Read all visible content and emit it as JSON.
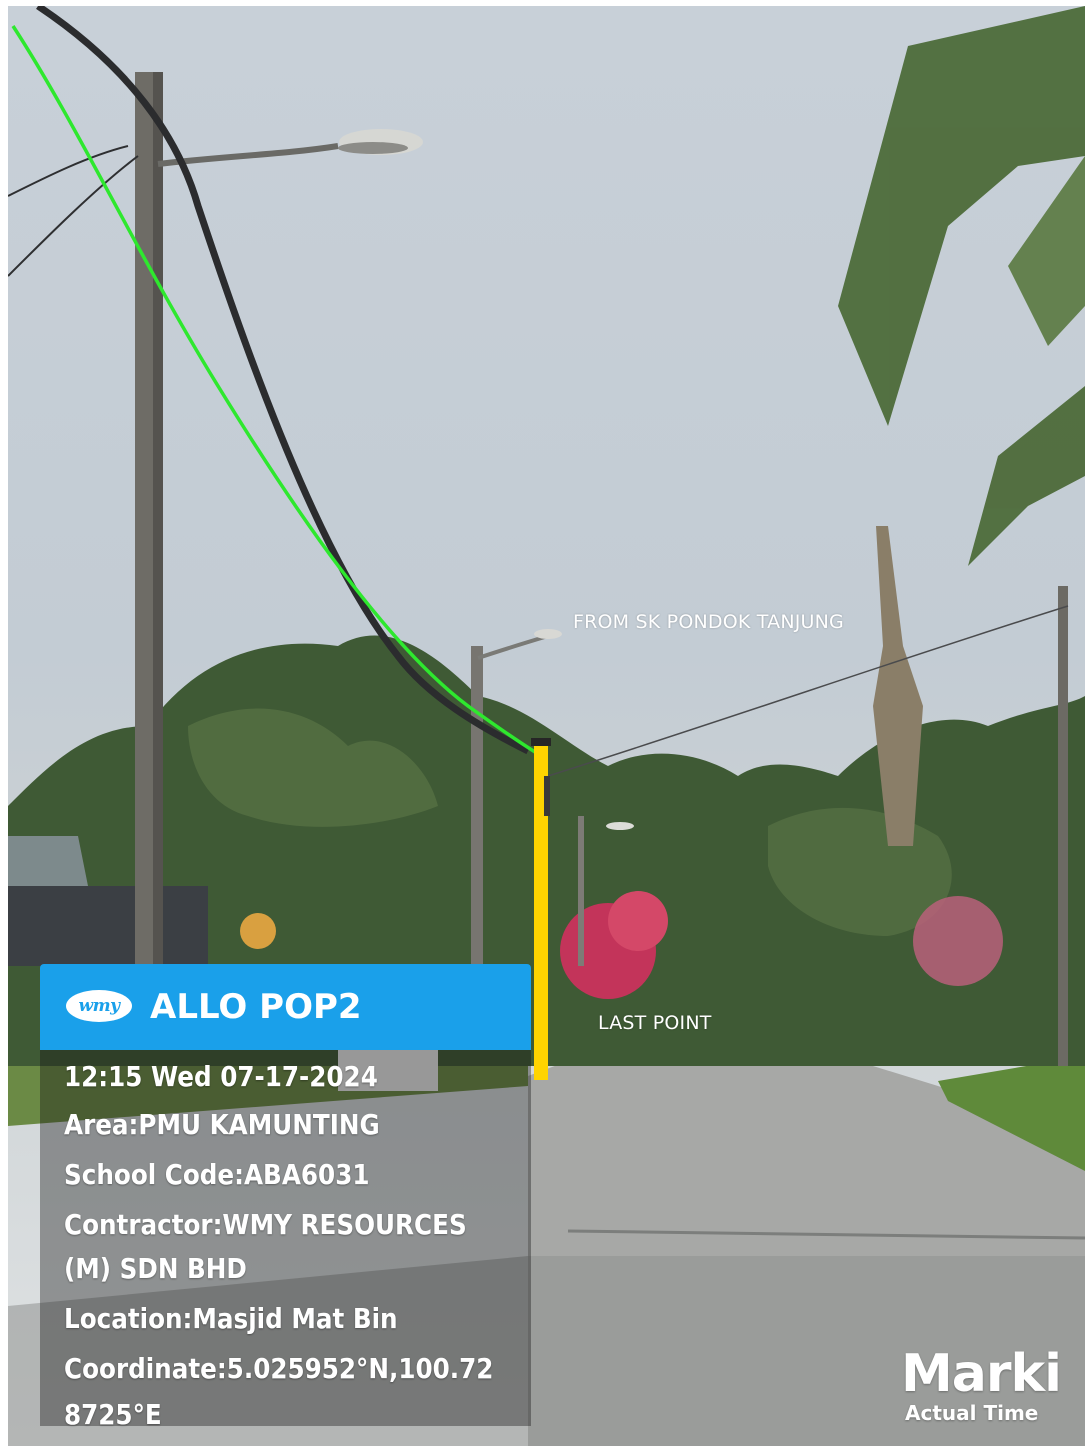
{
  "photo": {
    "annotation_top": "FROM SK PONDOK TANJUNG",
    "annotation_bottom": "LAST POINT",
    "route_color": "#2ee82e",
    "pole_marker_color": "#ffd400"
  },
  "stamp": {
    "logo_text": "wmy",
    "title": "ALLO POP2",
    "header_color": "#1aa0ea",
    "lines": [
      "12:15 Wed 07-17-2024",
      "Area:PMU KAMUNTING",
      "School Code:ABA6031",
      "Contractor:WMY RESOURCES",
      "(M) SDN BHD",
      "Location:Masjid Mat Bin",
      "Coordinate:5.025952°N,100.72",
      "8725°E"
    ]
  },
  "watermark": {
    "name": "Marki",
    "subtitle": "Actual Time"
  }
}
